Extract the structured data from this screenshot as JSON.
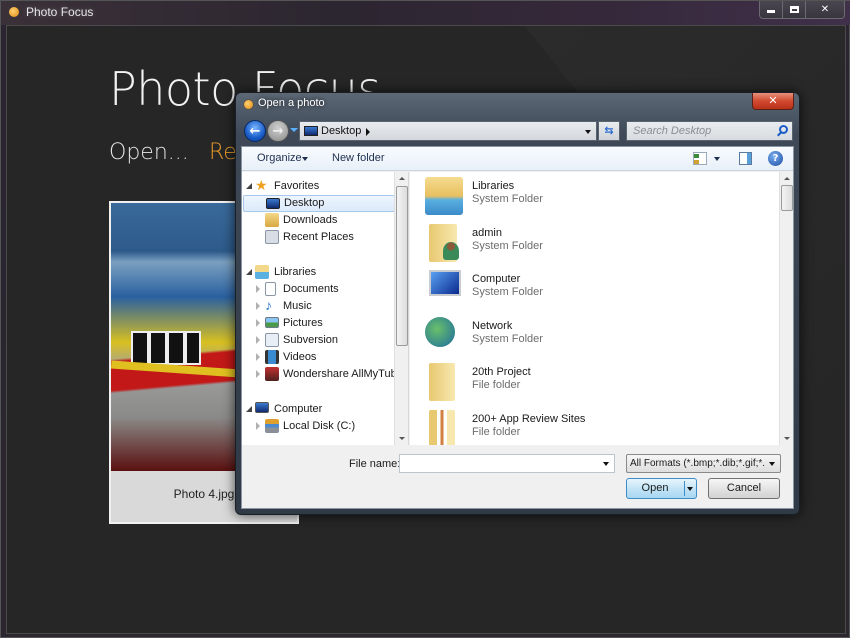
{
  "app": {
    "window_title": "Photo Focus",
    "heading": "Photo Focus",
    "nav": {
      "open": "Open...",
      "recent": "Rec"
    },
    "accent_color": "#e89a2a",
    "recent_photo": {
      "caption": "Photo 4.jpg"
    }
  },
  "dialog": {
    "title": "Open a photo",
    "address": {
      "location": "Desktop"
    },
    "search": {
      "placeholder": "Search Desktop"
    },
    "toolbar": {
      "organize": "Organize",
      "new_folder": "New folder"
    },
    "nav_pane": {
      "items": [
        {
          "label": "Favorites",
          "level": 0,
          "expanded": true,
          "icon": "star-icon"
        },
        {
          "label": "Desktop",
          "level": 1,
          "selected": true,
          "icon": "desktop-icon"
        },
        {
          "label": "Downloads",
          "level": 1,
          "icon": "downloads-icon"
        },
        {
          "label": "Recent Places",
          "level": 1,
          "icon": "recent-places-icon"
        },
        {
          "label": "Libraries",
          "level": 0,
          "expanded": true,
          "icon": "libraries-icon"
        },
        {
          "label": "Documents",
          "level": 1,
          "icon": "documents-icon"
        },
        {
          "label": "Music",
          "level": 1,
          "icon": "music-icon"
        },
        {
          "label": "Pictures",
          "level": 1,
          "icon": "pictures-icon"
        },
        {
          "label": "Subversion",
          "level": 1,
          "icon": "subversion-icon"
        },
        {
          "label": "Videos",
          "level": 1,
          "icon": "videos-icon"
        },
        {
          "label": "Wondershare AllMyTube",
          "level": 1,
          "icon": "wondershare-icon"
        },
        {
          "label": "Computer",
          "level": 0,
          "expanded": true,
          "icon": "computer-icon"
        },
        {
          "label": "Local Disk (C:)",
          "level": 1,
          "icon": "local-disk-icon"
        }
      ]
    },
    "files": [
      {
        "name": "Libraries",
        "type": "System Folder",
        "icon": "libraries-folder-icon"
      },
      {
        "name": "admin",
        "type": "System Folder",
        "icon": "user-folder-icon"
      },
      {
        "name": "Computer",
        "type": "System Folder",
        "icon": "computer-icon"
      },
      {
        "name": "Network",
        "type": "System Folder",
        "icon": "network-icon"
      },
      {
        "name": "20th Project",
        "type": "File folder",
        "icon": "folder-icon"
      },
      {
        "name": "200+ App Review Sites",
        "type": "File folder",
        "icon": "folder-icon"
      }
    ],
    "file_name": {
      "label": "File name:",
      "value": ""
    },
    "format_filter": "All Formats (*.bmp;*.dib;*.gif;*.",
    "buttons": {
      "open": "Open",
      "cancel": "Cancel"
    }
  }
}
